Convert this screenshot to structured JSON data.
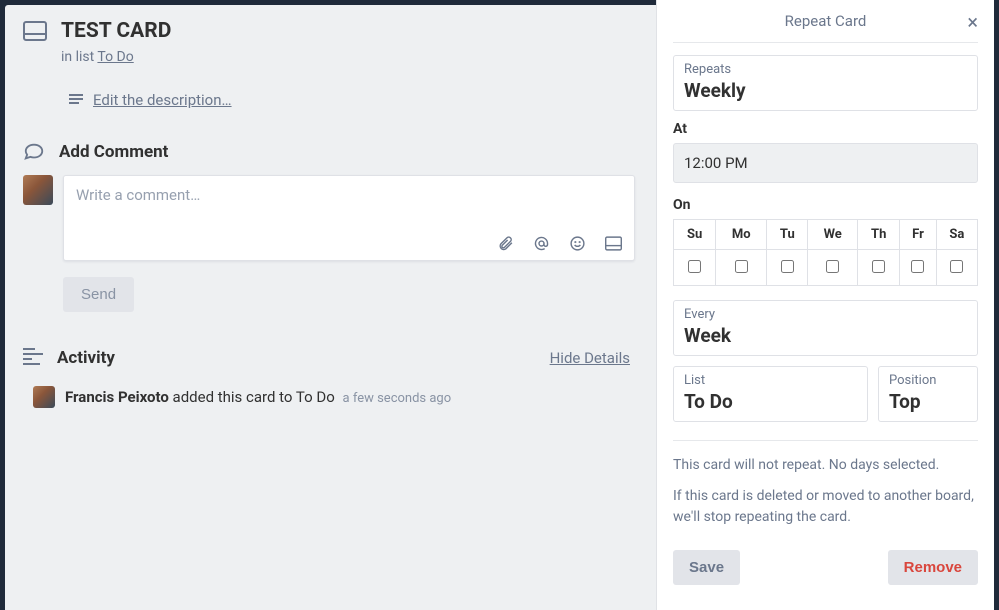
{
  "card": {
    "title": "TEST CARD",
    "in_list_prefix": "in list ",
    "list_name": "To Do",
    "edit_description": "Edit the description…"
  },
  "comment": {
    "section_title": "Add Comment",
    "placeholder": "Write a comment…",
    "send_label": "Send"
  },
  "activity": {
    "section_title": "Activity",
    "hide_details": "Hide Details",
    "items": [
      {
        "author": "Francis Peixoto",
        "action": "added this card to To Do",
        "time": "a few seconds ago"
      }
    ]
  },
  "panel": {
    "title": "Repeat Card",
    "repeats_label": "Repeats",
    "repeats_value": "Weekly",
    "at_label": "At",
    "at_value": "12:00 PM",
    "on_label": "On",
    "days": [
      "Su",
      "Mo",
      "Tu",
      "We",
      "Th",
      "Fr",
      "Sa"
    ],
    "every_label": "Every",
    "every_value": "Week",
    "list_label": "List",
    "list_value": "To Do",
    "position_label": "Position",
    "position_value": "Top",
    "warn1": "This card will not repeat. No days selected.",
    "warn2": "If this card is deleted or moved to another board, we'll stop repeating the card.",
    "save_label": "Save",
    "remove_label": "Remove"
  }
}
